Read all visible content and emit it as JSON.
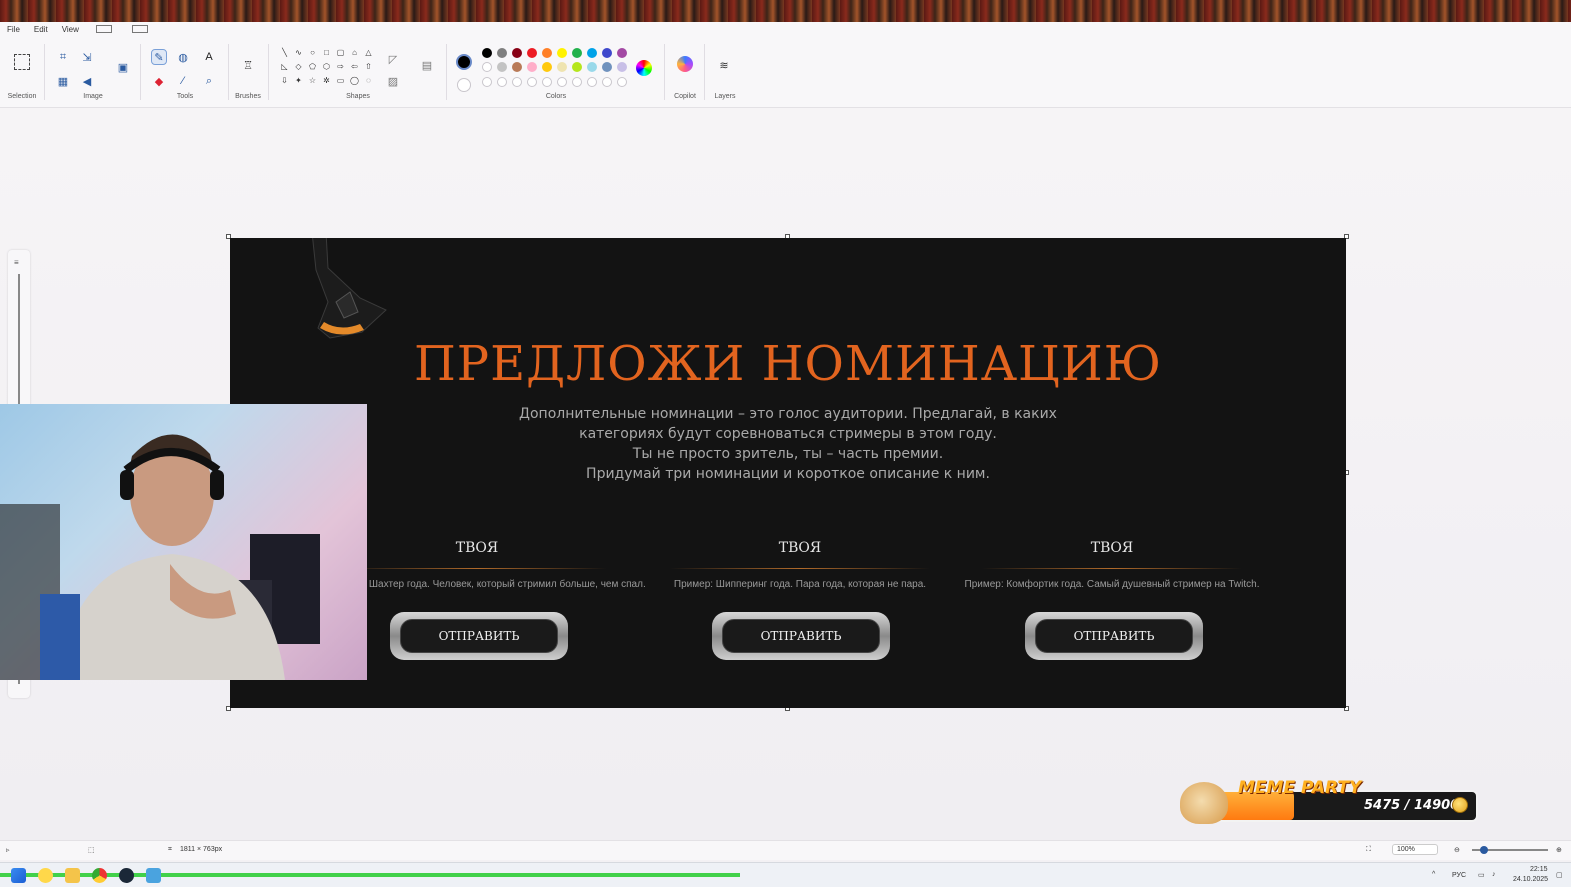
{
  "menu": {
    "file": "File",
    "edit": "Edit",
    "view": "View"
  },
  "ribbon": {
    "groups": {
      "selection": "Selection",
      "image": "Image",
      "tools": "Tools",
      "brushes": "Brushes",
      "shapes": "Shapes",
      "colors": "Colors",
      "copilot": "Copilot",
      "layers": "Layers"
    },
    "palette_row1": [
      "#000000",
      "#7f7f7f",
      "#880015",
      "#ed1c24",
      "#ff7f27",
      "#fff200",
      "#22b14c",
      "#00a2e8",
      "#3f48cc",
      "#a349a4"
    ],
    "palette_row2": [
      "#ffffff",
      "#c3c3c3",
      "#b97a57",
      "#ffaec9",
      "#ffc90e",
      "#efe4b0",
      "#b5e61d",
      "#99d9ea",
      "#7092be",
      "#c8bfe7"
    ],
    "primary_color": "#000000",
    "secondary_color": "#ffffff"
  },
  "canvas": {
    "headline": "ПРЕДЛОЖИ НОМИНАЦИЮ",
    "description": [
      "Дополнительные номинации – это голос аудитории. Предлагай, в каких",
      "категориях будут соревноваться стримеры в этом году.",
      "Ты не просто зритель, ты – часть премии.",
      "Придумай три номинации и короткое описание к ним."
    ],
    "cards": [
      {
        "title": "ТВОЯ",
        "example": "Пример: Шахтер года. Человек, который стримил больше, чем спал.",
        "button": "ОТПРАВИТЬ"
      },
      {
        "title": "ТВОЯ",
        "example": "Пример: Шипперинг года. Пара года, которая не пара.",
        "button": "ОТПРАВИТЬ"
      },
      {
        "title": "ТВОЯ",
        "example": "Пример: Комфортик года. Самый душевный стример на Twitch.",
        "button": "ОТПРАВИТЬ"
      }
    ],
    "accent_color": "#e2641f",
    "background_color": "#131313"
  },
  "status": {
    "canvas_size": "1811 × 763px",
    "zoom": "100%"
  },
  "overlay": {
    "meme_title": "MEME PARTY",
    "meme_count": "5475 / 14900",
    "meme_progress": 0.37
  },
  "taskbar": {
    "language": "РУС",
    "time": "22:15",
    "date": "24.10.2025"
  }
}
